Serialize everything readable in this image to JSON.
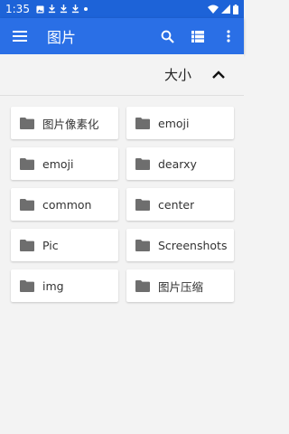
{
  "status_bar": {
    "time": "1:35",
    "icons": [
      "image-icon",
      "download-icon",
      "download-icon",
      "download-icon",
      "dot-icon"
    ],
    "right_icons": [
      "wifi-icon",
      "signal-icon",
      "battery-icon"
    ]
  },
  "app_bar": {
    "title": "图片",
    "actions": [
      "search-icon",
      "view-list-icon",
      "more-vert-icon"
    ]
  },
  "sort_bar": {
    "label": "大小",
    "direction_icon": "chevron-up-icon"
  },
  "folders": [
    {
      "label": "图片像素化"
    },
    {
      "label": "emoji"
    },
    {
      "label": "emoji"
    },
    {
      "label": "dearxy"
    },
    {
      "label": "common"
    },
    {
      "label": "center"
    },
    {
      "label": "Pic"
    },
    {
      "label": "Screenshots"
    },
    {
      "label": "img"
    },
    {
      "label": "图片压缩"
    }
  ],
  "colors": {
    "status_bar": "#1d63d8",
    "app_bar": "#2a6fe6",
    "background": "#f3f3f3",
    "folder_icon": "#6e6e6e"
  }
}
